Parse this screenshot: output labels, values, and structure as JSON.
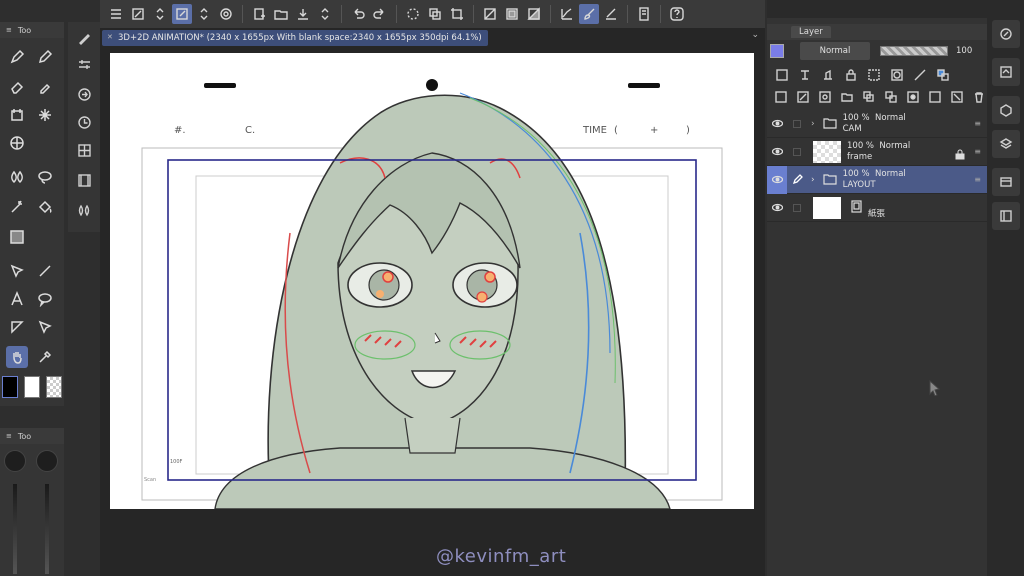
{
  "document_tab": {
    "title": "3D+2D ANIMATION* (2340 x 1655px With blank space:2340 x 1655px 350dpi 64.1%)"
  },
  "left_panel": {
    "header_label": "Too",
    "bottom_header_label": "Too"
  },
  "toolbar": {
    "icons": [
      "menu-icon",
      "canvas-icon",
      "transform-icon",
      "chevron-updown-icon",
      "snap-icon",
      "new-icon",
      "open-icon",
      "save-icon",
      "chevron-updown-icon",
      "undo-icon",
      "redo-icon",
      "loading-icon",
      "layer-copy-icon",
      "crop-icon",
      "no-fill-icon",
      "fill-icon",
      "layer-fill-icon",
      "vector-icon",
      "brush-icon",
      "ruler-icon",
      "page-icon",
      "help-icon"
    ]
  },
  "layer_panel": {
    "tab_label": "Layer",
    "blend_mode": "Normal",
    "opacity": "100",
    "layers": [
      {
        "opacity": "100 %",
        "blend": "Normal",
        "name": "CAM",
        "type": "folder",
        "selected": false,
        "locked": false
      },
      {
        "opacity": "100 %",
        "blend": "Normal",
        "name": "frame",
        "type": "raster",
        "selected": false,
        "locked": true
      },
      {
        "opacity": "100 %",
        "blend": "Normal",
        "name": "LAYOUT",
        "type": "folder",
        "selected": true,
        "locked": false
      },
      {
        "opacity": "",
        "blend": "",
        "name": "紙張",
        "type": "paper",
        "selected": false,
        "locked": false
      }
    ]
  },
  "canvas": {
    "header_num": "#.",
    "header_c": "C.",
    "header_time": "TIME",
    "header_paren_open": "(",
    "header_plus": "+",
    "header_paren_close": ")",
    "small_label": "100F",
    "small_label_2": "Scan"
  },
  "watermark": "@kevinfm_art",
  "colors": {
    "accent": "#5b6fa8",
    "frame_blue": "#2a2a8a",
    "skin_fill": "#bcc9b9"
  }
}
